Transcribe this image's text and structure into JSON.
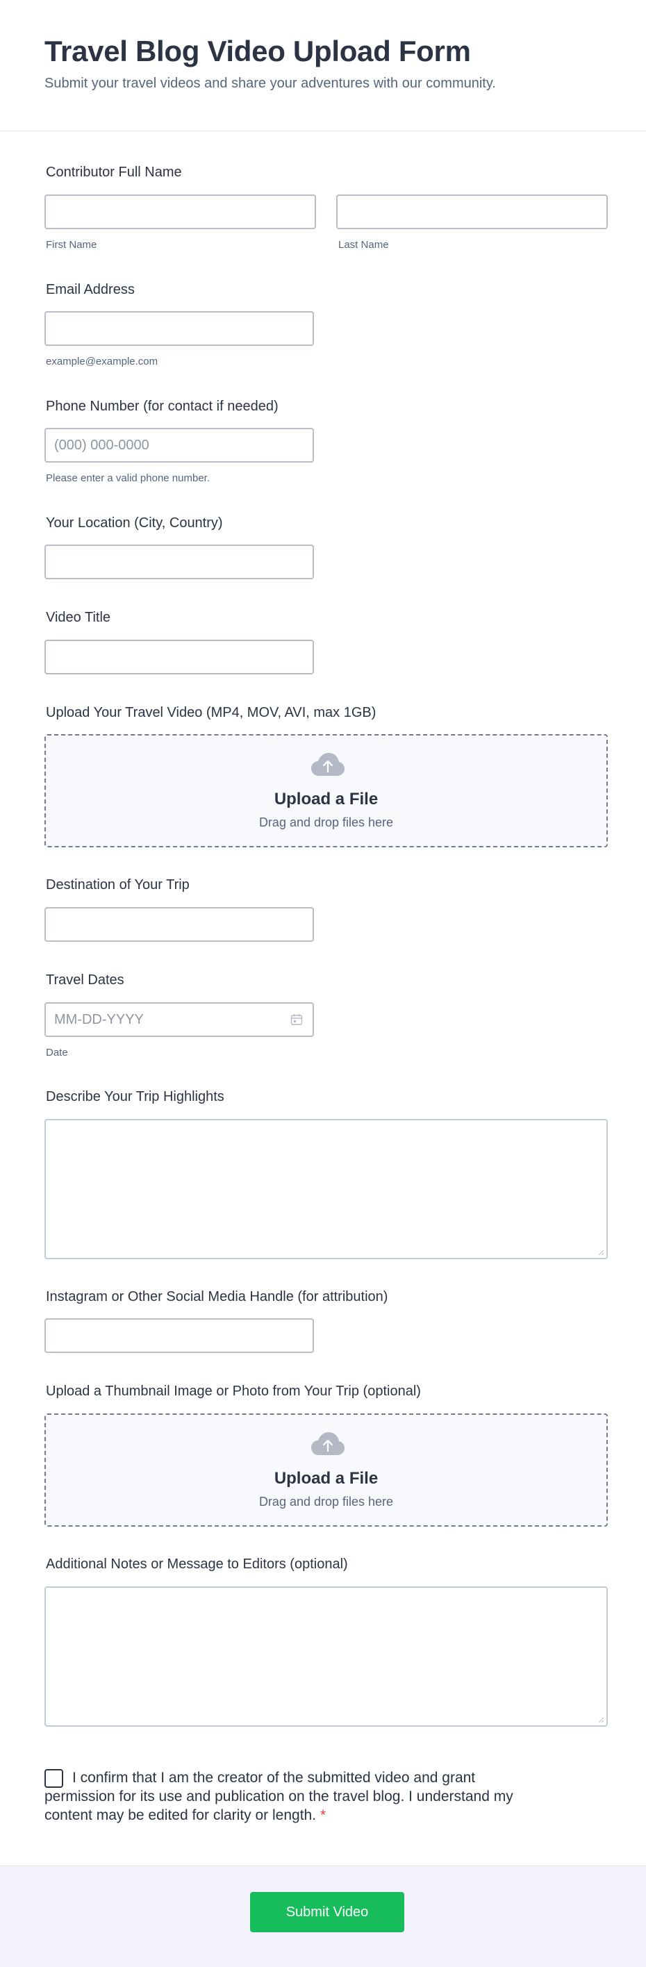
{
  "header": {
    "title": "Travel Blog Video Upload Form",
    "subtitle": "Submit your travel videos and share your adventures with our community."
  },
  "fields": {
    "name": {
      "label": "Contributor Full Name",
      "first_sublabel": "First Name",
      "last_sublabel": "Last Name"
    },
    "email": {
      "label": "Email Address",
      "sublabel": "example@example.com"
    },
    "phone": {
      "label": "Phone Number (for contact if needed)",
      "placeholder": "(000) 000-0000",
      "sublabel": "Please enter a valid phone number."
    },
    "location": {
      "label": "Your Location (City, Country)"
    },
    "video_title": {
      "label": "Video Title"
    },
    "video_upload": {
      "label": "Upload Your Travel Video (MP4, MOV, AVI, max 1GB)",
      "title": "Upload a File",
      "subtitle": "Drag and drop files here"
    },
    "destination": {
      "label": "Destination of Your Trip"
    },
    "travel_dates": {
      "label": "Travel Dates",
      "placeholder": "MM-DD-YYYY",
      "sublabel": "Date"
    },
    "highlights": {
      "label": "Describe Your Trip Highlights"
    },
    "social": {
      "label": "Instagram or Other Social Media Handle (for attribution)"
    },
    "thumbnail_upload": {
      "label": "Upload a Thumbnail Image or Photo from Your Trip (optional)",
      "title": "Upload a File",
      "subtitle": "Drag and drop files here"
    },
    "notes": {
      "label": "Additional Notes or Message to Editors (optional)"
    },
    "consent": {
      "text": "I confirm that I am the creator of the submitted video and grant permission for its use and publication on the travel blog. I understand my content may be edited for clarity or length.",
      "required_mark": "*"
    }
  },
  "footer": {
    "submit_label": "Submit Video"
  },
  "icons": {
    "upload": "cloud-upload-icon",
    "calendar": "calendar-icon"
  },
  "colors": {
    "accent": "#18bd5b",
    "required": "#f23a3c",
    "text": "#2c3345",
    "muted": "#57647e"
  }
}
